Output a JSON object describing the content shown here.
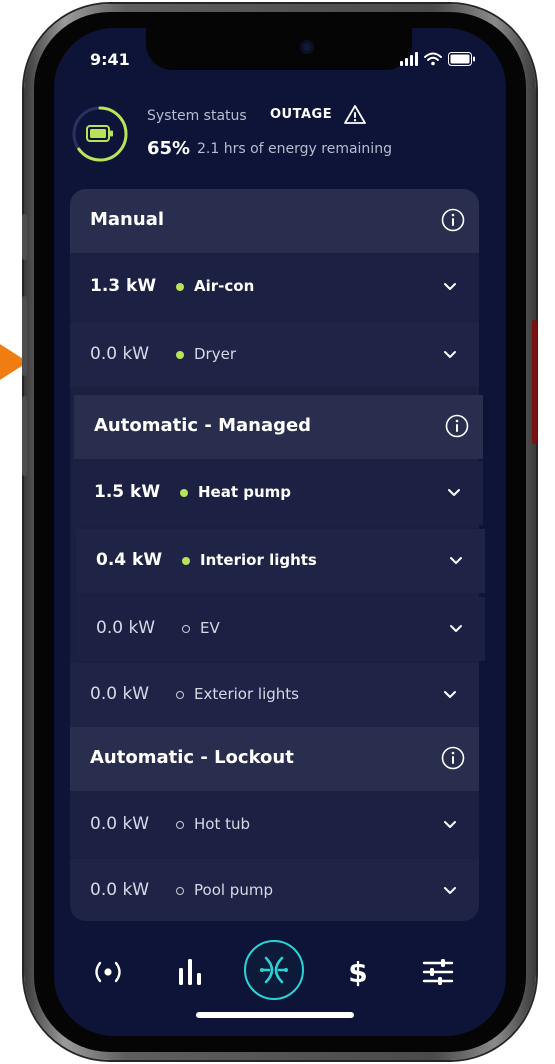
{
  "status_bar": {
    "time": "9:41"
  },
  "system": {
    "label": "System status",
    "value": "OUTAGE",
    "percent": "65%",
    "battery_level": 0.65,
    "remaining": "2.1 hrs of energy remaining"
  },
  "sections": [
    {
      "title": "Manual",
      "items": [
        {
          "kw": "1.3 kW",
          "name": "Air-con",
          "active": true
        },
        {
          "kw": "0.0 kW",
          "name": "Dryer",
          "active": true
        }
      ]
    },
    {
      "title": "Automatic - Managed",
      "items": [
        {
          "kw": "1.5 kW",
          "name": "Heat pump",
          "active": true
        },
        {
          "kw": "0.4 kW",
          "name": "Interior lights",
          "active": true
        },
        {
          "kw": "0.0 kW",
          "name": "EV",
          "active": false
        },
        {
          "kw": "0.0 kW",
          "name": "Exterior lights",
          "active": false
        }
      ]
    },
    {
      "title": "Automatic - Lockout",
      "items": [
        {
          "kw": "0.0 kW",
          "name": "Hot tub",
          "active": false
        },
        {
          "kw": "0.0 kW",
          "name": "Pool pump",
          "active": false
        }
      ]
    }
  ],
  "tabs": [
    {
      "icon": "radio-status-icon",
      "selected": false
    },
    {
      "icon": "bar-chart-icon",
      "selected": false
    },
    {
      "icon": "circuit-hub-icon",
      "selected": true
    },
    {
      "icon": "dollar-icon",
      "selected": false
    },
    {
      "icon": "sliders-icon",
      "selected": false
    }
  ],
  "colors": {
    "background": "#0e1438",
    "accent_green": "#b9e45a",
    "accent_teal": "#2bd4d4",
    "side_arrow": "#f07c12"
  }
}
